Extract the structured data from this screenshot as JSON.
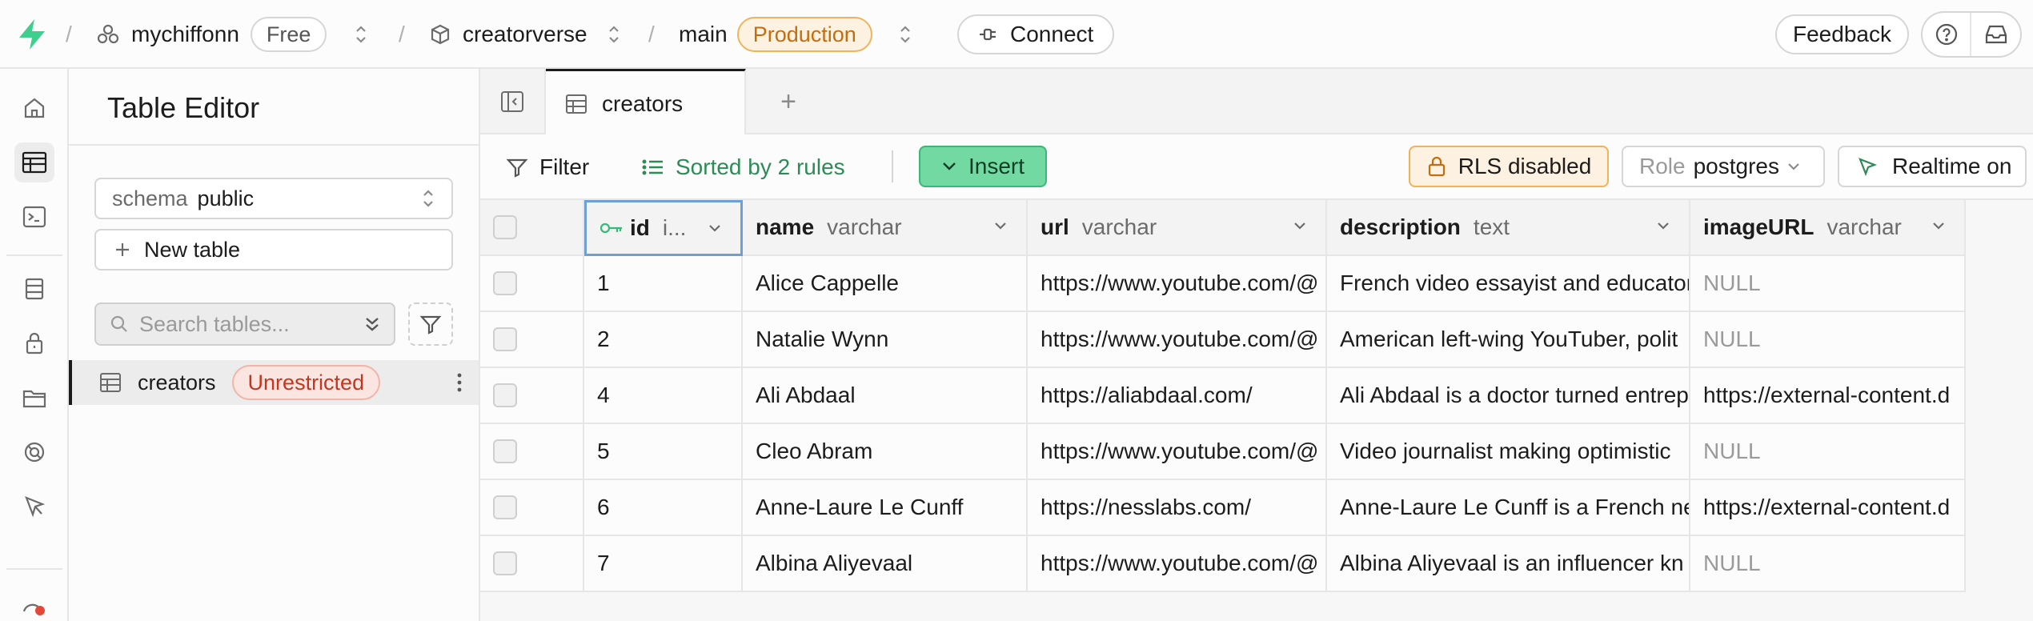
{
  "topbar": {
    "org_name": "mychiffonn",
    "plan_badge": "Free",
    "project_name": "creatorverse",
    "branch_name": "main",
    "env_badge": "Production",
    "connect_label": "Connect",
    "feedback_label": "Feedback",
    "separator": "/"
  },
  "sidebar": {
    "title": "Table Editor",
    "schema_label": "schema",
    "schema_value": "public",
    "new_table_label": "New table",
    "search_placeholder": "Search tables...",
    "tables": [
      {
        "name": "creators",
        "badge": "Unrestricted"
      }
    ]
  },
  "tabs": {
    "active_tab": "creators",
    "add_tab": "+"
  },
  "toolbar": {
    "filter_label": "Filter",
    "sort_label": "Sorted by 2 rules",
    "insert_label": "Insert",
    "rls_label": "RLS disabled",
    "role_label": "Role",
    "role_value": "postgres",
    "realtime_label": "Realtime on"
  },
  "colors": {
    "accent_green": "#3ab77a",
    "insert_bg": "#73d9a3",
    "production_orange": "#c56d0c",
    "unrestricted_red": "#c3361f"
  },
  "columns": [
    {
      "name": "id",
      "type": "i..."
    },
    {
      "name": "name",
      "type": "varchar"
    },
    {
      "name": "url",
      "type": "varchar"
    },
    {
      "name": "description",
      "type": "text"
    },
    {
      "name": "imageURL",
      "type": "varchar"
    }
  ],
  "rows": [
    {
      "id": "1",
      "name": "Alice Cappelle",
      "url": "https://www.youtube.com/@",
      "description": "French video essayist and educator",
      "imageURL": "NULL"
    },
    {
      "id": "2",
      "name": "Natalie Wynn",
      "url": "https://www.youtube.com/@",
      "description": "American left-wing YouTuber, polit",
      "imageURL": "NULL"
    },
    {
      "id": "4",
      "name": "Ali Abdaal",
      "url": "https://aliabdaal.com/",
      "description": "Ali Abdaal is a doctor turned entrep",
      "imageURL": "https://external-content.d"
    },
    {
      "id": "5",
      "name": "Cleo Abram",
      "url": "https://www.youtube.com/@",
      "description": "Video journalist making optimistic",
      "imageURL": "NULL"
    },
    {
      "id": "6",
      "name": "Anne-Laure Le Cunff",
      "url": "https://nesslabs.com/",
      "description": "Anne-Laure Le Cunff is a French ne",
      "imageURL": "https://external-content.d"
    },
    {
      "id": "7",
      "name": "Albina Aliyevaal",
      "url": "https://www.youtube.com/@",
      "description": "Albina Aliyevaal is an influencer kn",
      "imageURL": "NULL"
    }
  ]
}
